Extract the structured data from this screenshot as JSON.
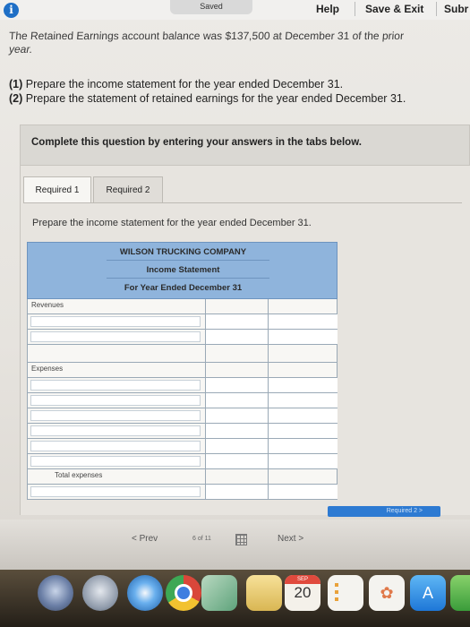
{
  "topbar": {
    "info_icon": "i",
    "saved": "Saved",
    "help": "Help",
    "save_exit": "Save & Exit",
    "submit": "Subr"
  },
  "intro": {
    "line1": "The Retained Earnings account balance was $137,500 at December 31 of the prior",
    "line2": "year."
  },
  "requirements": {
    "r1_num": "(1)",
    "r1_text": " Prepare the income statement for the year ended December 31.",
    "r2_num": "(2)",
    "r2_text": " Prepare the statement of retained earnings for the year ended December 31."
  },
  "instruction": "Complete this question by entering your answers in the tabs below.",
  "tabs": [
    {
      "label": "Required 1"
    },
    {
      "label": "Required 2"
    }
  ],
  "prompt": "Prepare the income statement for the year ended December 31.",
  "statement": {
    "company": "WILSON TRUCKING COMPANY",
    "title": "Income Statement",
    "period": "For Year Ended December 31",
    "revenues_label": "Revenues",
    "expenses_label": "Expenses",
    "total_expenses_label": "Total expenses"
  },
  "navigation": {
    "next_required": "Required 2 >",
    "prev": "< Prev",
    "page_info": "6 of 11",
    "next": "Next >"
  },
  "dock": {
    "calendar_month": "SEP",
    "calendar_day": "20"
  }
}
